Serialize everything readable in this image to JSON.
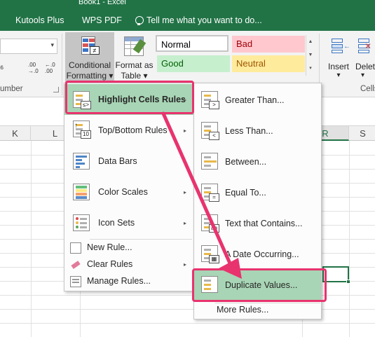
{
  "window": {
    "title": "Book1 - Excel"
  },
  "tabs": {
    "kutools": "Kutools Plus",
    "wps_pdf": "WPS PDF",
    "tell_me": "Tell me what you want to do..."
  },
  "ribbon": {
    "number_group_label": "umber",
    "percent_glyph": "⁶",
    "inc_decimal": ".00 →.0",
    "dec_decimal": "←.0 .00",
    "cells_group_label": "Cells",
    "conditional_formatting": {
      "line1": "Conditional",
      "line2": "Formatting ▾"
    },
    "format_as_table": {
      "line1": "Format as",
      "line2": "Table ▾"
    },
    "styles": {
      "normal": "Normal",
      "bad": "Bad",
      "good": "Good",
      "neutral": "Neutral"
    },
    "insert": {
      "label": "Insert",
      "arrow": "▾"
    },
    "delete": {
      "label": "Delet",
      "arrow": "▾"
    },
    "colors": {
      "accent": "#217346",
      "good_bg": "#c6efce",
      "bad_bg": "#ffc7ce",
      "neutral_bg": "#ffeb9c"
    }
  },
  "sheet": {
    "columns": [
      "K",
      "L",
      "R",
      "S"
    ],
    "selected_column": "R"
  },
  "cf_menu": {
    "items": [
      {
        "label": "Highlight Cells Rules",
        "icon": "highlight-cells-icon"
      },
      {
        "label": "Top/Bottom Rules",
        "icon": "top-bottom-icon",
        "badge": "10"
      },
      {
        "label": "Data Bars",
        "icon": "data-bars-icon"
      },
      {
        "label": "Color Scales",
        "icon": "color-scales-icon"
      },
      {
        "label": "Icon Sets",
        "icon": "icon-sets-icon"
      }
    ],
    "small_items": [
      {
        "label": "New Rule..."
      },
      {
        "label": "Clear Rules"
      },
      {
        "label": "Manage Rules..."
      }
    ],
    "submenu_arrow": "▸"
  },
  "submenu": {
    "items": [
      {
        "label": "Greater Than...",
        "badge": ">"
      },
      {
        "label": "Less Than...",
        "badge": "<"
      },
      {
        "label": "Between...",
        "badge": ""
      },
      {
        "label": "Equal To...",
        "badge": "="
      },
      {
        "label": "Text that Contains...",
        "badge": "ab"
      },
      {
        "label": "A Date Occurring...",
        "badge": ""
      },
      {
        "label": "Duplicate Values...",
        "badge": ""
      }
    ],
    "more": "More Rules..."
  },
  "annotation": {
    "highlight_color": "#e8336e",
    "menu_highlight_color": "#a8d5b5"
  }
}
